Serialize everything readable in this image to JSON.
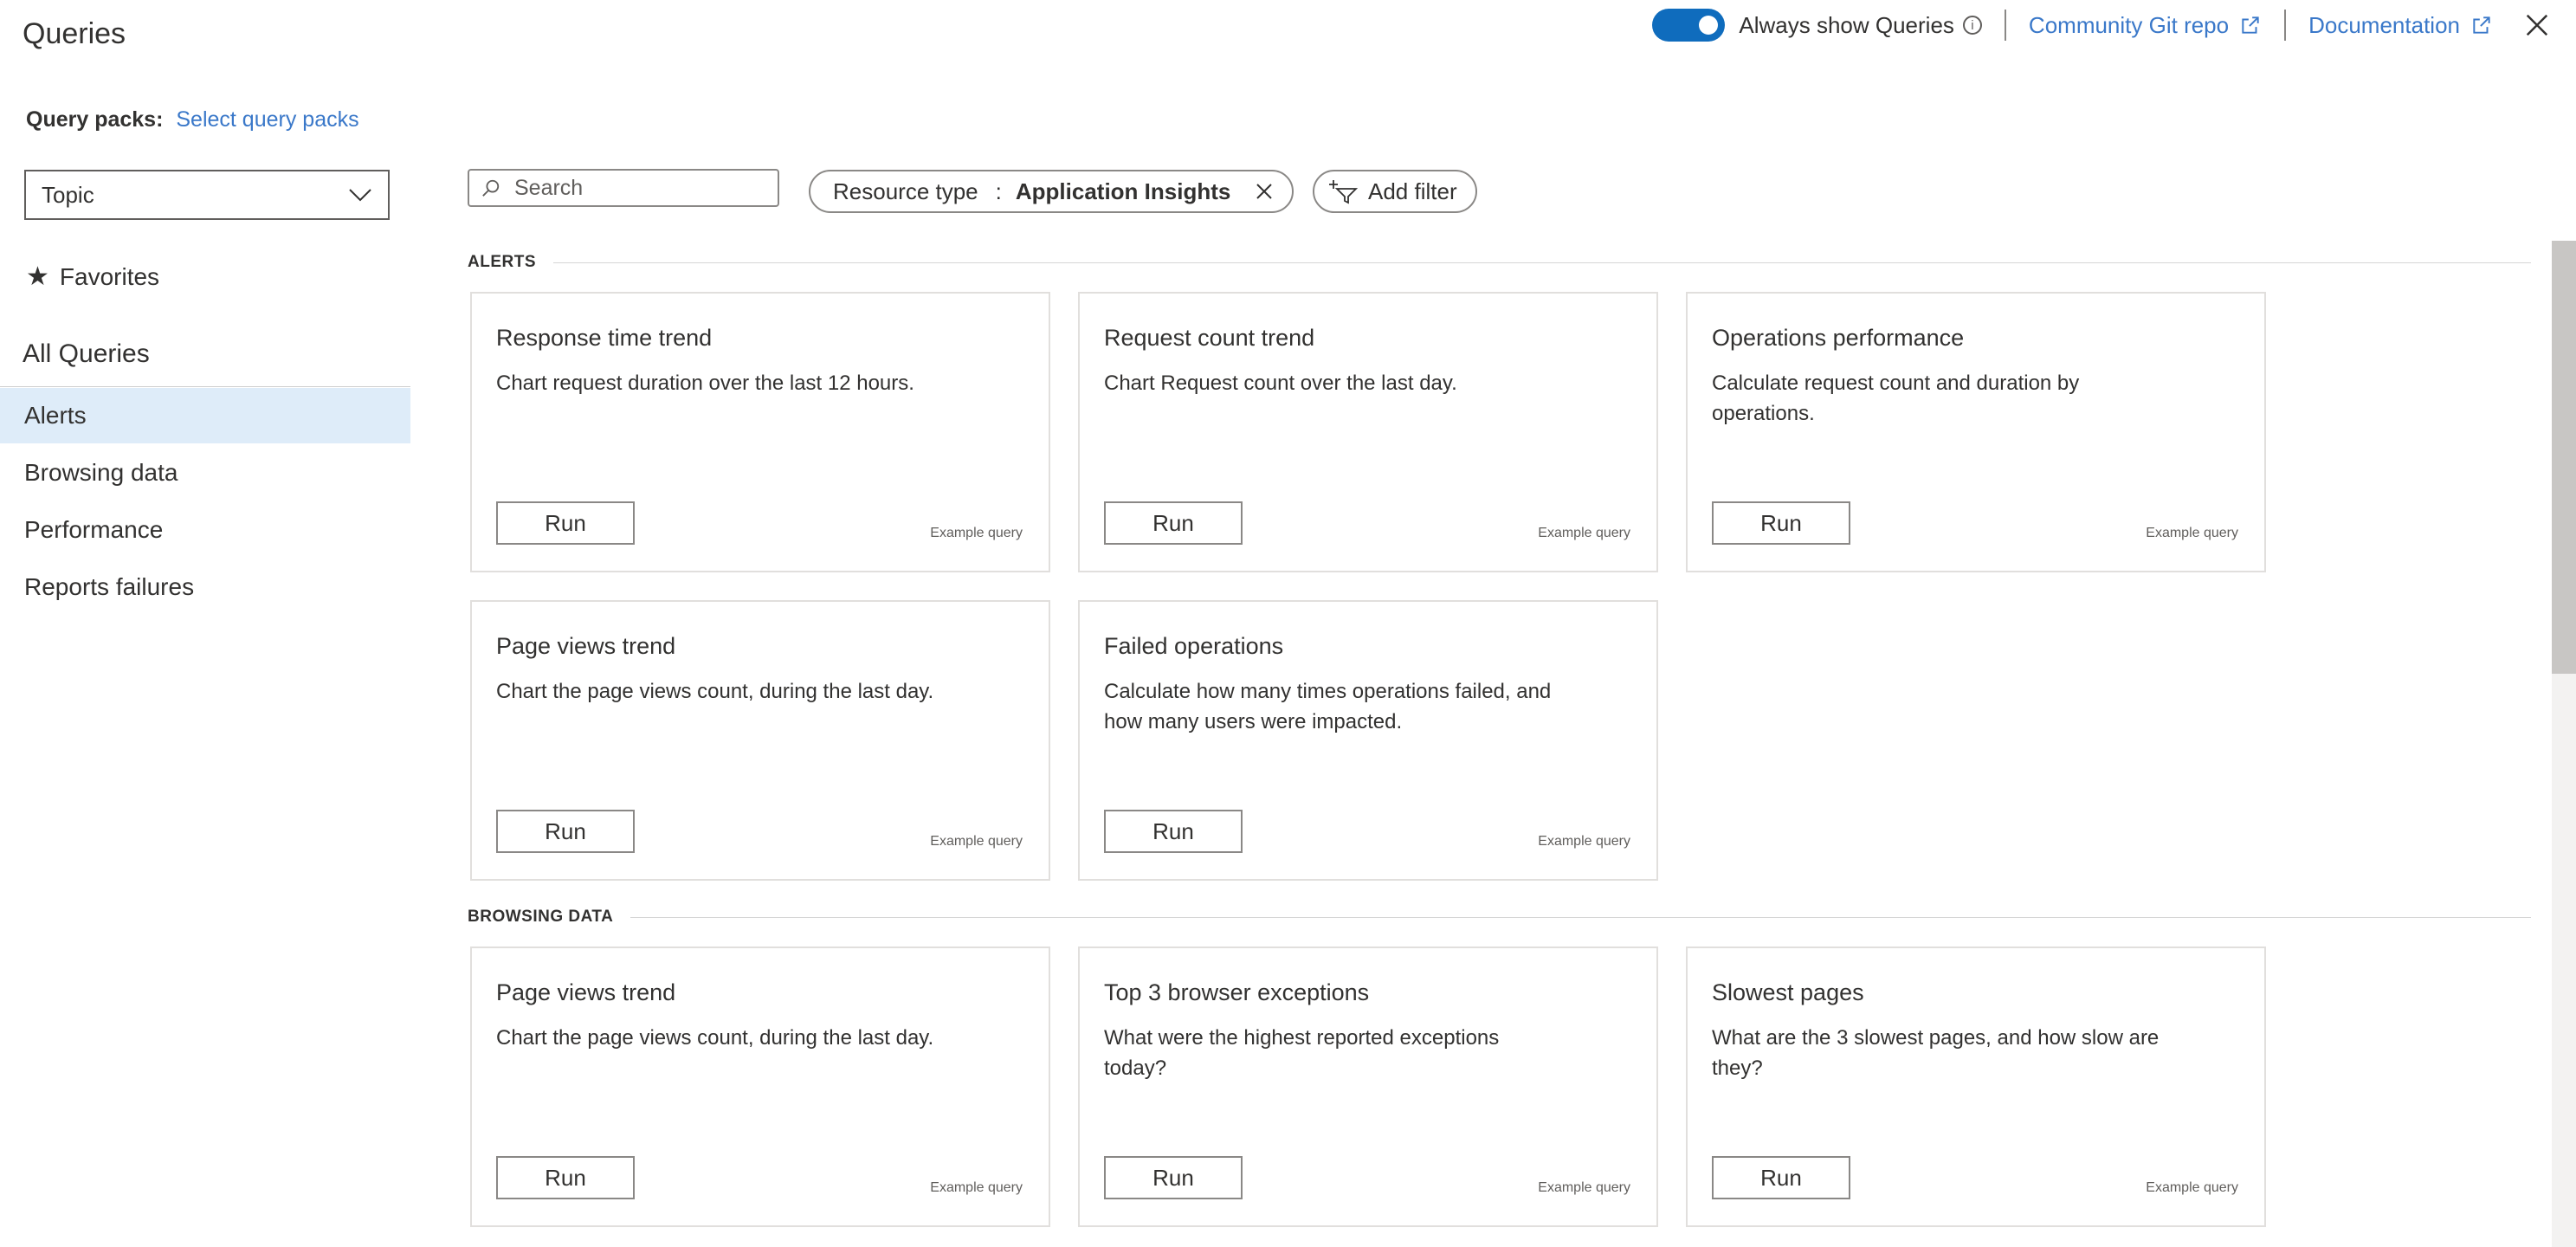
{
  "header": {
    "title": "Queries",
    "toggle_label": "Always show Queries",
    "toggle_on": true,
    "community_link": "Community Git repo",
    "documentation_link": "Documentation",
    "accent_color": "#0f6cbd",
    "link_color": "#3a78c9"
  },
  "query_packs": {
    "label": "Query packs:",
    "link": "Select query packs"
  },
  "sidebar": {
    "dropdown_value": "Topic",
    "favorites_label": "Favorites",
    "all_queries_label": "All Queries",
    "items": [
      {
        "label": "Alerts",
        "active": true
      },
      {
        "label": "Browsing data",
        "active": false
      },
      {
        "label": "Performance",
        "active": false
      },
      {
        "label": "Reports failures",
        "active": false
      }
    ]
  },
  "toolbar": {
    "search_placeholder": "Search",
    "filter_key": "Resource type",
    "filter_separator": ":",
    "filter_value": "Application Insights",
    "add_filter_label": "Add filter"
  },
  "sections": [
    {
      "title": "ALERTS",
      "cards": [
        {
          "title": "Response time trend",
          "desc": "Chart request duration over the last 12 hours.",
          "run": "Run",
          "tag": "Example query"
        },
        {
          "title": "Request count trend",
          "desc": "Chart Request count over the last day.",
          "run": "Run",
          "tag": "Example query"
        },
        {
          "title": "Operations performance",
          "desc": "Calculate request count and duration by operations.",
          "run": "Run",
          "tag": "Example query"
        },
        {
          "title": "Page views trend",
          "desc": "Chart the page views count, during the last day.",
          "run": "Run",
          "tag": "Example query"
        },
        {
          "title": "Failed operations",
          "desc": "Calculate how many times operations failed, and how many users were impacted.",
          "run": "Run",
          "tag": "Example query"
        }
      ]
    },
    {
      "title": "BROWSING DATA",
      "cards": [
        {
          "title": "Page views trend",
          "desc": "Chart the page views count, during the last day.",
          "run": "Run",
          "tag": "Example query"
        },
        {
          "title": "Top 3 browser exceptions",
          "desc": "What were the highest reported exceptions today?",
          "run": "Run",
          "tag": "Example query"
        },
        {
          "title": "Slowest pages",
          "desc": "What are the 3 slowest pages, and how slow are they?",
          "run": "Run",
          "tag": "Example query"
        }
      ]
    }
  ]
}
